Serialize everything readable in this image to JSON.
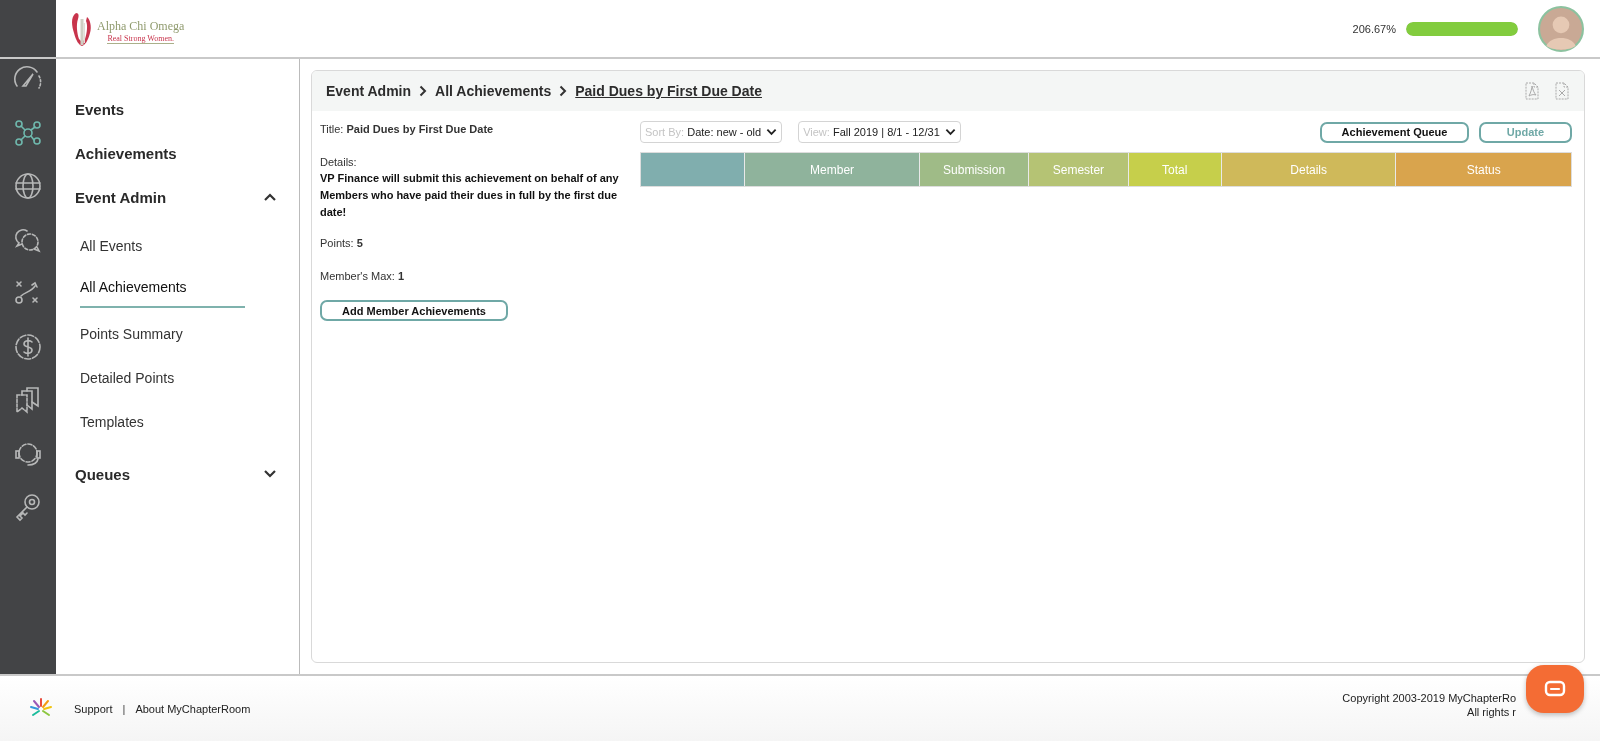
{
  "header": {
    "logo": {
      "name": "Alpha Chi Omega",
      "tagline": "Real Strong Women."
    },
    "progress": {
      "reading": "206.67%",
      "level": 1
    }
  },
  "rail": [
    {
      "kind": "gauge",
      "selected": false
    },
    {
      "kind": "network",
      "selected": true
    },
    {
      "kind": "globe",
      "selected": false
    },
    {
      "kind": "chat",
      "selected": false
    },
    {
      "kind": "plays",
      "selected": false
    },
    {
      "kind": "dollar",
      "selected": false
    },
    {
      "kind": "bookmarks",
      "selected": false
    },
    {
      "kind": "headset",
      "selected": false
    },
    {
      "kind": "key",
      "selected": false
    }
  ],
  "sidebar": {
    "items": [
      {
        "label": "Events"
      },
      {
        "label": "Achievements"
      },
      {
        "label": "Event Admin",
        "expanded": true,
        "children": [
          {
            "label": "All Events",
            "selected": false
          },
          {
            "label": "All Achievements",
            "selected": true
          },
          {
            "label": "Points Summary",
            "selected": false
          },
          {
            "label": "Detailed Points",
            "selected": false
          },
          {
            "label": "Templates",
            "selected": false
          }
        ]
      },
      {
        "label": "Queues",
        "expanded": false
      }
    ]
  },
  "panel": {
    "breadcrumb": [
      {
        "label": "Event Admin",
        "current": false
      },
      {
        "label": "All Achievements",
        "current": false
      },
      {
        "label": "Paid Dues by First Due Date",
        "current": true
      }
    ],
    "info": {
      "title_label": "Title:",
      "title": "Paid Dues by First Due Date",
      "details_label": "Details:",
      "details": "VP Finance will submit this achievement on behalf of any Members who have paid their dues in full by the first due date!",
      "points_label": "Points:",
      "points": "5",
      "max_label": "Member's Max:",
      "max": "1"
    },
    "add_button": "Add Member Achievements",
    "filters": [
      {
        "label": "Sort By:",
        "value": "Date: new - old"
      },
      {
        "label": "View:",
        "value": "Fall 2019 | 8/1 - 12/31"
      }
    ],
    "buttons": [
      {
        "label": "Achievement Queue",
        "kind": "primary"
      },
      {
        "label": "Update",
        "kind": "secondary"
      }
    ],
    "table": {
      "columns": [
        {
          "color": "#80aeae"
        },
        {
          "label": "Member",
          "color": "#8fb39c"
        },
        {
          "label": "Submission",
          "color": "#9fbb87"
        },
        {
          "label": "Semester",
          "color": "#b5c374"
        },
        {
          "label": "Total",
          "color": "#c6cf4b"
        },
        {
          "label": "Details",
          "color": "#cfb95a"
        },
        {
          "label": "Status",
          "color": "#d9a44d"
        }
      ]
    }
  },
  "footer": {
    "links": [
      "Support",
      "About MyChapterRoom"
    ],
    "separator": "|",
    "copyright": "Copyright 2003-2019 MyChapterRo",
    "rights": "All rights r"
  }
}
